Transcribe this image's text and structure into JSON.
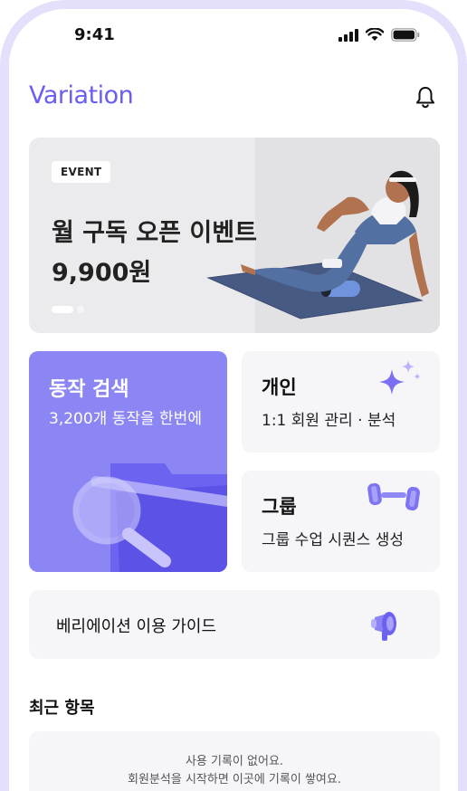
{
  "status_bar": {
    "time": "9:41",
    "icons": [
      "signal-icon",
      "wifi-icon",
      "battery-icon"
    ]
  },
  "header": {
    "logo": "Variation",
    "bell_icon": "bell-icon"
  },
  "banner": {
    "badge": "EVENT",
    "title_line1": "월 구독 오픈 이벤트",
    "title_line2": "9,900원",
    "page_indicator": {
      "current": 1,
      "total": 2
    }
  },
  "cards": {
    "search": {
      "title": "동작 검색",
      "subtitle": "3,200개 동작을 한번에"
    },
    "personal": {
      "title": "개인",
      "subtitle": "1:1 회원 관리 · 분석",
      "icon": "sparkle-icon"
    },
    "group": {
      "title": "그룹",
      "subtitle": "그룹 수업 시퀀스 생성",
      "icon": "dumbbell-icon"
    },
    "guide": {
      "label": "베리에이션 이용 가이드",
      "icon": "megaphone-icon"
    }
  },
  "recent": {
    "title": "최근 항목",
    "empty_line1": "사용 기록이 없어요.",
    "empty_line2": "회원분석을 시작하면 이곳에 기록이 쌓여요."
  },
  "colors": {
    "brand": "#6a5df1",
    "search_card": "#8c86f4",
    "frame": "#e4e0fb"
  }
}
